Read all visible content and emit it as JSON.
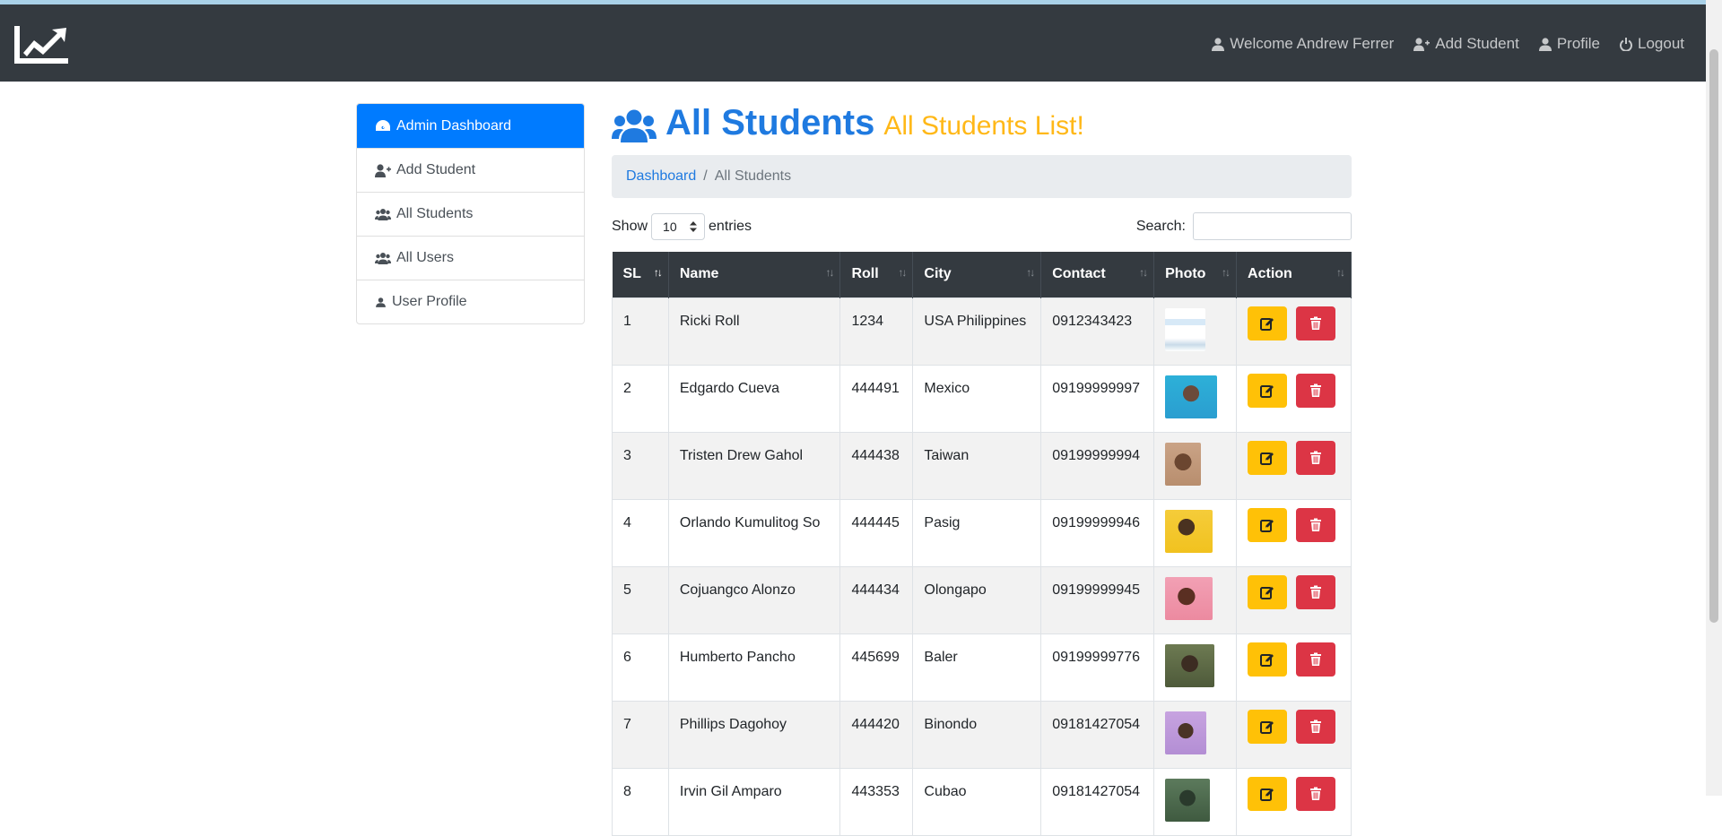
{
  "nav": {
    "links": [
      "Welcome Andrew Ferrer",
      "Add Student",
      "Profile",
      "Logout"
    ]
  },
  "sidebar": {
    "items": [
      "Admin Dashboard",
      "Add Student",
      "All Students",
      "All Users",
      "User Profile"
    ]
  },
  "header": {
    "title": "All Students",
    "subtitle": "All Students List!"
  },
  "breadcrumb": {
    "home": "Dashboard",
    "current": "All Students"
  },
  "controls": {
    "show_label": "Show",
    "entries_value": "10",
    "entries_label": "entries",
    "search_label": "Search:"
  },
  "table": {
    "columns": [
      "SL",
      "Name",
      "Roll",
      "City",
      "Contact",
      "Photo",
      "Action"
    ],
    "rows": [
      {
        "sl": "1",
        "name": "Ricki Roll",
        "roll": "1234",
        "city": "USA Philippines",
        "contact": "0912343423"
      },
      {
        "sl": "2",
        "name": "Edgardo Cueva",
        "roll": "444491",
        "city": "Mexico",
        "contact": "09199999997"
      },
      {
        "sl": "3",
        "name": "Tristen Drew Gahol",
        "roll": "444438",
        "city": "Taiwan",
        "contact": "09199999994"
      },
      {
        "sl": "4",
        "name": "Orlando Kumulitog So",
        "roll": "444445",
        "city": "Pasig",
        "contact": "09199999946"
      },
      {
        "sl": "5",
        "name": "Cojuangco Alonzo",
        "roll": "444434",
        "city": "Olongapo",
        "contact": "09199999945"
      },
      {
        "sl": "6",
        "name": "Humberto Pancho",
        "roll": "445699",
        "city": "Baler",
        "contact": "09199999776"
      },
      {
        "sl": "7",
        "name": "Phillips Dagohoy",
        "roll": "444420",
        "city": "Binondo",
        "contact": "09181427054"
      },
      {
        "sl": "8",
        "name": "Irvin Gil Amparo",
        "roll": "443353",
        "city": "Cubao",
        "contact": "09181427054"
      }
    ]
  },
  "colors": {
    "primary": "#007bff",
    "title_blue": "#1f7ae0",
    "subtitle_yellow": "#ffb818",
    "navbar": "#343a40",
    "edit_button": "#ffc107",
    "delete_button": "#dc3545"
  }
}
